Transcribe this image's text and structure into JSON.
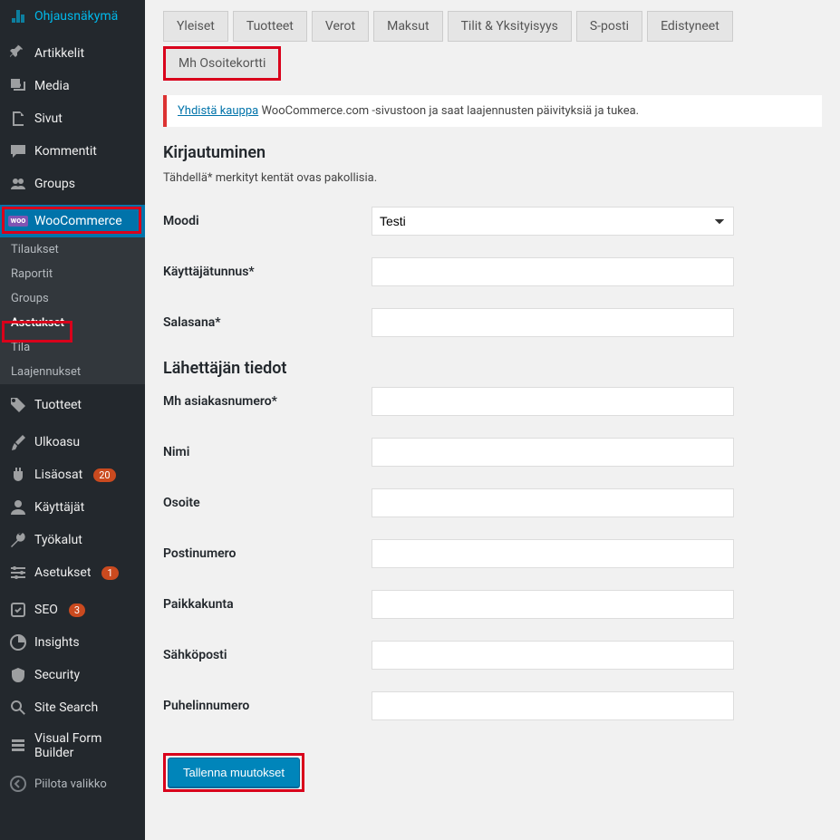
{
  "sidebar": {
    "items": [
      {
        "icon": "dashboard",
        "label": "Ohjausnäkymä"
      },
      {
        "icon": "pin",
        "label": "Artikkelit"
      },
      {
        "icon": "media",
        "label": "Media"
      },
      {
        "icon": "page",
        "label": "Sivut"
      },
      {
        "icon": "comment",
        "label": "Kommentit"
      },
      {
        "icon": "groups",
        "label": "Groups"
      },
      {
        "icon": "woo",
        "label": "WooCommerce",
        "active": true
      },
      {
        "icon": "tag",
        "label": "Tuotteet"
      },
      {
        "icon": "brush",
        "label": "Ulkoasu"
      },
      {
        "icon": "plugin",
        "label": "Lisäosat",
        "badge": "20"
      },
      {
        "icon": "user",
        "label": "Käyttäjät"
      },
      {
        "icon": "tool",
        "label": "Työkalut"
      },
      {
        "icon": "settings",
        "label": "Asetukset",
        "badge": "1"
      },
      {
        "icon": "seo",
        "label": "SEO",
        "badge": "3"
      },
      {
        "icon": "insights",
        "label": "Insights"
      },
      {
        "icon": "shield",
        "label": "Security"
      },
      {
        "icon": "search",
        "label": "Site Search"
      },
      {
        "icon": "form",
        "label": "Visual Form Builder"
      }
    ],
    "submenu": [
      {
        "label": "Tilaukset"
      },
      {
        "label": "Raportit"
      },
      {
        "label": "Groups"
      },
      {
        "label": "Asetukset",
        "active": true
      },
      {
        "label": "Tila"
      },
      {
        "label": "Laajennukset"
      }
    ],
    "collapse": "Piilota valikko"
  },
  "tabs": [
    {
      "label": "Yleiset"
    },
    {
      "label": "Tuotteet"
    },
    {
      "label": "Verot"
    },
    {
      "label": "Maksut"
    },
    {
      "label": "Tilit & Yksityisyys"
    },
    {
      "label": "S-posti"
    },
    {
      "label": "Edistyneet"
    },
    {
      "label": "Mh Osoitekortti",
      "highlighted": true
    }
  ],
  "notice": {
    "link": "Yhdistä kauppa",
    "text": " WooCommerce.com -sivustoon ja saat laajennusten päivityksiä ja tukea."
  },
  "section1_title": "Kirjautuminen",
  "section1_desc": "Tähdellä* merkityt kentät ovas pakollisia.",
  "fields1": [
    {
      "label": "Moodi",
      "type": "select",
      "value": "Testi"
    },
    {
      "label": "Käyttäjätunnus*",
      "type": "text",
      "value": ""
    },
    {
      "label": "Salasana*",
      "type": "text",
      "value": ""
    }
  ],
  "section2_title": "Lähettäjän tiedot",
  "fields2": [
    {
      "label": "Mh asiakasnumero*",
      "type": "text",
      "value": ""
    },
    {
      "label": "Nimi",
      "type": "text",
      "value": ""
    },
    {
      "label": "Osoite",
      "type": "text",
      "value": ""
    },
    {
      "label": "Postinumero",
      "type": "text",
      "value": ""
    },
    {
      "label": "Paikkakunta",
      "type": "text",
      "value": ""
    },
    {
      "label": "Sähköposti",
      "type": "text",
      "value": ""
    },
    {
      "label": "Puhelinnumero",
      "type": "text",
      "value": ""
    }
  ],
  "save_label": "Tallenna muutokset"
}
